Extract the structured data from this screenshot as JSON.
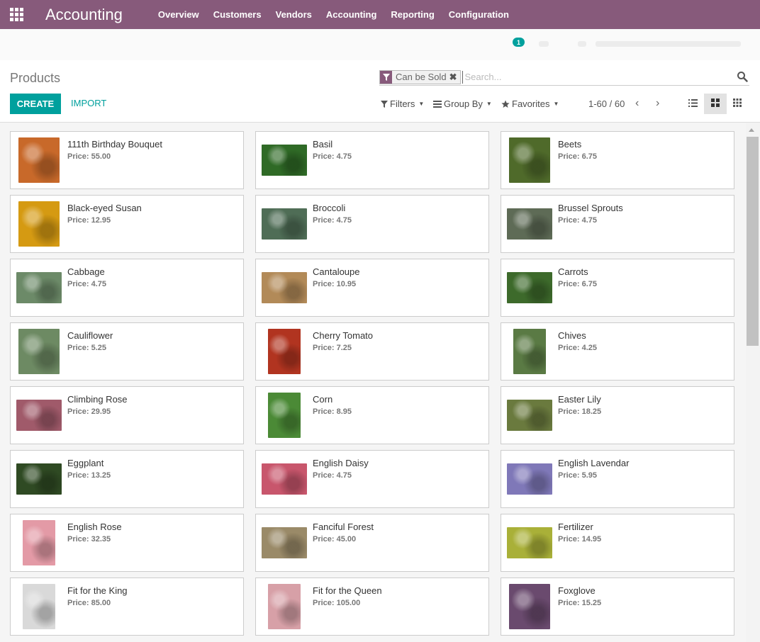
{
  "app": {
    "brand": "Accounting"
  },
  "menu": [
    "Overview",
    "Customers",
    "Vendors",
    "Accounting",
    "Reporting",
    "Configuration"
  ],
  "systray": {
    "badge_count": "1"
  },
  "page": {
    "title": "Products"
  },
  "search": {
    "facet_label": "Can be Sold",
    "facet_remove": "✖",
    "placeholder": "Search..."
  },
  "actions": {
    "create": "CREATE",
    "import": "IMPORT"
  },
  "filters": {
    "filters": "Filters",
    "group_by": "Group By",
    "favorites": "Favorites"
  },
  "pager": {
    "value": "1-60 / 60"
  },
  "colors": {
    "brand": "#875a7b",
    "accent": "#00a09d"
  },
  "products": [
    {
      "name": "111th Birthday Bouquet",
      "price": "Price: 55.00",
      "tone": "#c8692a",
      "shape": "tall"
    },
    {
      "name": "Basil",
      "price": "Price: 4.75",
      "tone": "#2f6a26",
      "shape": "wide"
    },
    {
      "name": "Beets",
      "price": "Price: 6.75",
      "tone": "#4f6a2a",
      "shape": "tall"
    },
    {
      "name": "Black-eyed Susan",
      "price": "Price: 12.95",
      "tone": "#d59a12",
      "shape": "tall"
    },
    {
      "name": "Broccoli",
      "price": "Price: 4.75",
      "tone": "#4f6d56",
      "shape": "wide"
    },
    {
      "name": "Brussel Sprouts",
      "price": "Price: 4.75",
      "tone": "#5e6b56",
      "shape": "wide"
    },
    {
      "name": "Cabbage",
      "price": "Price: 4.75",
      "tone": "#6c8a68",
      "shape": "wide"
    },
    {
      "name": "Cantaloupe",
      "price": "Price: 10.95",
      "tone": "#b28a58",
      "shape": "wide"
    },
    {
      "name": "Carrots",
      "price": "Price: 6.75",
      "tone": "#3d6a2b",
      "shape": "wide"
    },
    {
      "name": "Cauliflower",
      "price": "Price: 5.25",
      "tone": "#6d8a63",
      "shape": "tall"
    },
    {
      "name": "Cherry Tomato",
      "price": "Price: 7.25",
      "tone": "#b13420",
      "shape": "narrow"
    },
    {
      "name": "Chives",
      "price": "Price: 4.25",
      "tone": "#5a7a44",
      "shape": "narrow"
    },
    {
      "name": "Climbing Rose",
      "price": "Price: 29.95",
      "tone": "#a05a6a",
      "shape": "wide"
    },
    {
      "name": "Corn",
      "price": "Price: 8.95",
      "tone": "#4b8a36",
      "shape": "narrow"
    },
    {
      "name": "Easter Lily",
      "price": "Price: 18.25",
      "tone": "#6a7a3e",
      "shape": "wide"
    },
    {
      "name": "Eggplant",
      "price": "Price: 13.25",
      "tone": "#2f4a23",
      "shape": "wide"
    },
    {
      "name": "English Daisy",
      "price": "Price: 4.75",
      "tone": "#c8566c",
      "shape": "wide"
    },
    {
      "name": "English Lavendar",
      "price": "Price: 5.95",
      "tone": "#7f78b8",
      "shape": "wide"
    },
    {
      "name": "English Rose",
      "price": "Price: 32.35",
      "tone": "#e39aa6",
      "shape": "narrow"
    },
    {
      "name": "Fanciful Forest",
      "price": "Price: 45.00",
      "tone": "#9a8a68",
      "shape": "wide"
    },
    {
      "name": "Fertilizer",
      "price": "Price: 14.95",
      "tone": "#a9b038",
      "shape": "wide"
    },
    {
      "name": "Fit for the King",
      "price": "Price: 85.00",
      "tone": "#d9d9d9",
      "shape": "narrow"
    },
    {
      "name": "Fit for the Queen",
      "price": "Price: 105.00",
      "tone": "#d7a0a7",
      "shape": "narrow"
    },
    {
      "name": "Foxglove",
      "price": "Price: 15.25",
      "tone": "#6a4a6e",
      "shape": "tall"
    }
  ]
}
